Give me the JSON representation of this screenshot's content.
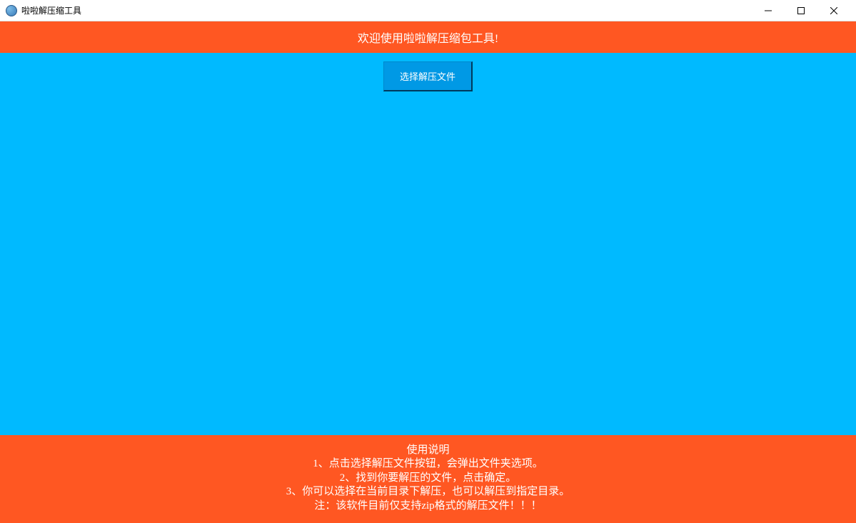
{
  "window": {
    "title": "啦啦解压缩工具"
  },
  "header": {
    "welcome_text": "欢迎使用啦啦解压缩包工具!"
  },
  "main": {
    "select_button_label": "选择解压文件"
  },
  "footer": {
    "title": "使用说明",
    "line1": "1、点击选择解压文件按钮，会弹出文件夹选项。",
    "line2": "2、找到你要解压的文件，点击确定。",
    "line3": "3、你可以选择在当前目录下解压，也可以解压到指定目录。",
    "note": "注：该软件目前仅支持zip格式的解压文件！！！"
  },
  "colors": {
    "accent_orange": "#ff5722",
    "main_blue": "#00baff",
    "button_blue": "#0099e5"
  }
}
